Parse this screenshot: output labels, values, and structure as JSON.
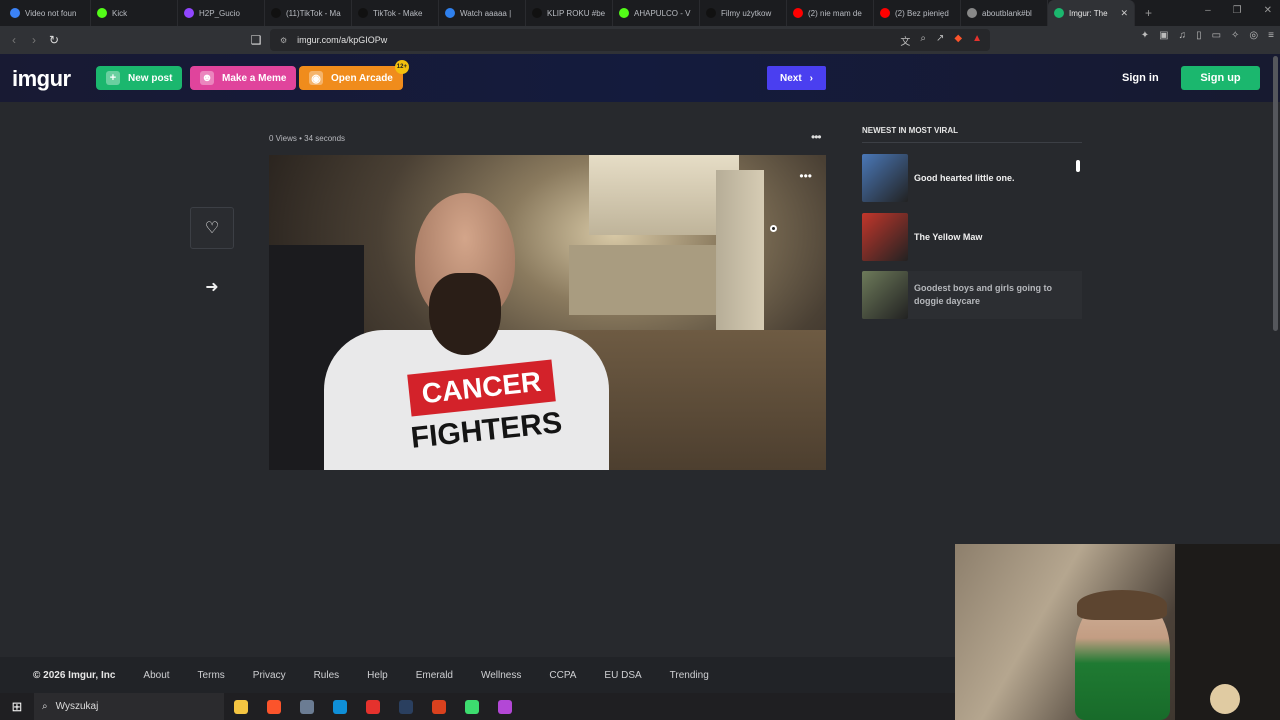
{
  "browser": {
    "tabs": [
      {
        "label": "Video not foun",
        "color": "#3b82f6"
      },
      {
        "label": "Kick",
        "color": "#53fc18"
      },
      {
        "label": "H2P_Gucio",
        "color": "#9146ff"
      },
      {
        "label": "(11)TikTok - Ma",
        "color": "#111111"
      },
      {
        "label": "TikTok - Make",
        "color": "#111111"
      },
      {
        "label": "Watch aaaaa |",
        "color": "#2f80ed"
      },
      {
        "label": "KLIP ROKU #be",
        "color": "#111111"
      },
      {
        "label": "AHAPULCO - V",
        "color": "#53fc18"
      },
      {
        "label": "Filmy użytkow",
        "color": "#111111"
      },
      {
        "label": "(2) nie mam de",
        "color": "#ff0000"
      },
      {
        "label": "(2) Bez pienięd",
        "color": "#ff0000"
      },
      {
        "label": "aboutblank#bl",
        "color": "#888888"
      },
      {
        "label": "Imgur: The",
        "color": "#1bb76e",
        "active": true
      }
    ],
    "new_tab": "+",
    "url": "imgur.com/a/kpGIOPw"
  },
  "header": {
    "logo": "imgur",
    "new_post": "New post",
    "make_meme": "Make a Meme",
    "open_arcade": "Open Arcade",
    "arcade_badge": "12+",
    "next": "Next",
    "sign_in": "Sign in",
    "sign_up": "Sign up",
    "colors": {
      "new_post": "#1bb76e",
      "make_meme": "#e0449c",
      "open_arcade": "#f08c1c",
      "next": "#4a3ff0",
      "sign_up": "#1bb76e"
    }
  },
  "post": {
    "views": "0 Views",
    "age": "34 seconds",
    "shirt_line1": "CANCER",
    "shirt_line2": "FIGHTERS"
  },
  "viral": {
    "title": "NEWEST IN MOST VIRAL",
    "items": [
      {
        "title": "Good hearted little one.",
        "thumb_color": "#4a78b8"
      },
      {
        "title": "The Yellow Maw",
        "thumb_color": "#c2362b"
      },
      {
        "title": "Goodest boys and girls going to doggie daycare",
        "thumb_color": "#6d7a5a"
      }
    ]
  },
  "footer": {
    "copyright": "© 2026 Imgur, Inc",
    "links": [
      "About",
      "Terms",
      "Privacy",
      "Rules",
      "Help",
      "Emerald",
      "Wellness",
      "CCPA",
      "EU DSA",
      "Trending"
    ]
  },
  "taskbar": {
    "search_placeholder": "Wyszukaj",
    "apps": [
      "#f4c542",
      "#fb542b",
      "#6b7c93",
      "#0f8fd8",
      "#e5322d",
      "#2a3f5f",
      "#d9411e",
      "#3ddc6f",
      "#b347d6"
    ]
  }
}
